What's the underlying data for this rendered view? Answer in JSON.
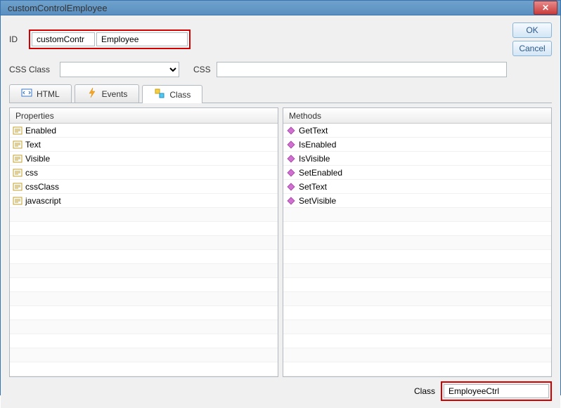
{
  "title": "customControlEmployee",
  "header": {
    "id_label": "ID",
    "id_prefix": "customContr",
    "id_value": "Employee",
    "ok_label": "OK",
    "cancel_label": "Cancel",
    "cssclass_label": "CSS Class",
    "cssclass_value": "",
    "css_label": "CSS",
    "css_value": ""
  },
  "tabs": [
    {
      "label": "HTML"
    },
    {
      "label": "Events"
    },
    {
      "label": "Class"
    }
  ],
  "panels": {
    "properties_header": "Properties",
    "methods_header": "Methods",
    "properties": [
      "Enabled",
      "Text",
      "Visible",
      "css",
      "cssClass",
      "javascript"
    ],
    "methods": [
      "GetText",
      "IsEnabled",
      "IsVisible",
      "SetEnabled",
      "SetText",
      "SetVisible"
    ]
  },
  "footer": {
    "class_label": "Class",
    "class_value": "EmployeeCtrl"
  }
}
